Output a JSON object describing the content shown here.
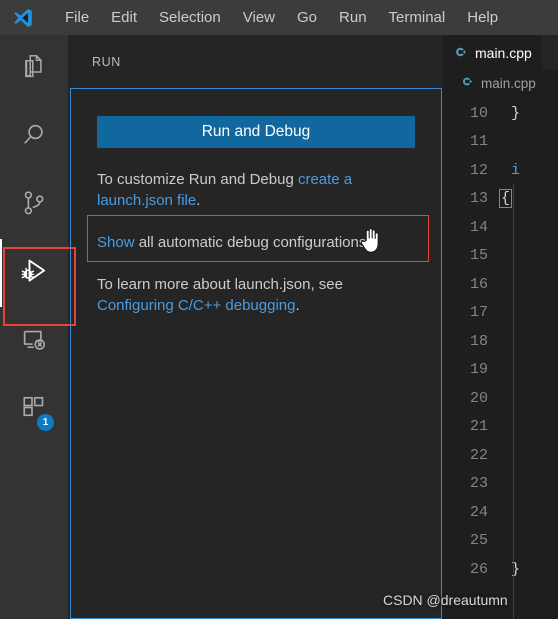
{
  "window": {
    "logo_icon": "vscode-logo-icon",
    "menu": [
      {
        "label": "File"
      },
      {
        "label": "Edit"
      },
      {
        "label": "Selection"
      },
      {
        "label": "View"
      },
      {
        "label": "Go"
      },
      {
        "label": "Run"
      },
      {
        "label": "Terminal"
      },
      {
        "label": "Help"
      }
    ]
  },
  "activity_bar": {
    "items": [
      {
        "name": "explorer",
        "icon": "files-icon",
        "active": false,
        "badge": ""
      },
      {
        "name": "search",
        "icon": "search-icon",
        "active": false,
        "badge": ""
      },
      {
        "name": "source-control",
        "icon": "source-control-icon",
        "active": false,
        "badge": ""
      },
      {
        "name": "run-and-debug",
        "icon": "run-and-debug-icon",
        "active": true,
        "badge": ""
      },
      {
        "name": "remote-explorer",
        "icon": "remote-explorer-icon",
        "active": false,
        "badge": ""
      },
      {
        "name": "extensions",
        "icon": "extensions-icon",
        "active": false,
        "badge": "1"
      }
    ]
  },
  "run_panel": {
    "header": "RUN",
    "run_debug_button": "Run and Debug",
    "customize": {
      "prefix": "To customize Run and Debug ",
      "link": "create a launch.json file",
      "suffix": "."
    },
    "show_auto": {
      "link": "Show",
      "rest": " all automatic debug configurations."
    },
    "learn_more": {
      "prefix": "To learn more about launch.json, see ",
      "link": "Configuring C/C++ debugging",
      "suffix": "."
    }
  },
  "editor": {
    "tab": {
      "label": "main.cpp",
      "icon": "cpp-file-icon"
    },
    "breadcrumb": {
      "label": "main.cpp",
      "icon": "cpp-file-icon"
    },
    "lines": [
      {
        "number": "10",
        "text": "}"
      },
      {
        "number": "11",
        "text": ""
      },
      {
        "number": "12",
        "text": "i"
      },
      {
        "number": "13",
        "text": "{"
      },
      {
        "number": "14",
        "text": ""
      },
      {
        "number": "15",
        "text": ""
      },
      {
        "number": "16",
        "text": ""
      },
      {
        "number": "17",
        "text": ""
      },
      {
        "number": "18",
        "text": ""
      },
      {
        "number": "19",
        "text": ""
      },
      {
        "number": "20",
        "text": ""
      },
      {
        "number": "21",
        "text": ""
      },
      {
        "number": "22",
        "text": ""
      },
      {
        "number": "23",
        "text": ""
      },
      {
        "number": "24",
        "text": ""
      },
      {
        "number": "25",
        "text": ""
      },
      {
        "number": "26",
        "text": "}"
      }
    ]
  },
  "annotations": {
    "watermark": "CSDN @dreautumn",
    "highlight_color": "#e8423b",
    "focus_border_color": "#3b8ad0",
    "accent_color": "#11689f",
    "link_color": "#4a9ce0",
    "badge_color": "#0e7ac4"
  }
}
